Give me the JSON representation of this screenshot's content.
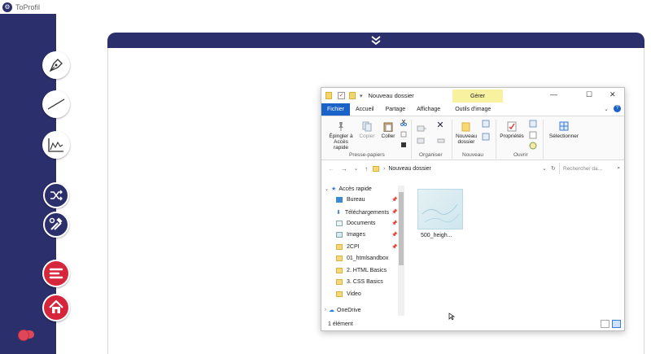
{
  "app": {
    "title": "ToProfil"
  },
  "explorer": {
    "title": "Nouveau dossier",
    "manage_tab": "Gérer",
    "tabs": [
      "Fichier",
      "Accueil",
      "Partage",
      "Affichage",
      "Outils d'image"
    ],
    "ribbon": {
      "pin_label": "Épingler à Accès rapide",
      "copy_label": "Copier",
      "paste_label": "Coller",
      "group_clipboard": "Presse-papiers",
      "group_organize": "Organiser",
      "new_folder_label": "Nouveau dossier",
      "group_new": "Nouveau",
      "properties_label": "Propriétés",
      "group_open": "Ouvrir",
      "select_label": "Sélectionner"
    },
    "address": {
      "path": "Nouveau dossier",
      "search_placeholder": "Rechercher da..."
    },
    "nav": {
      "quick_access": "Accès rapide",
      "items": [
        "Bureau",
        "Téléchargements",
        "Documents",
        "Images",
        "2CPI",
        "01_htmlsandbox",
        "2. HTML Basics",
        "3. CSS Basics",
        "Video"
      ],
      "onedrive": "OneDrive"
    },
    "files": [
      {
        "name": "500_heigh..."
      }
    ],
    "status": "1 élément"
  }
}
